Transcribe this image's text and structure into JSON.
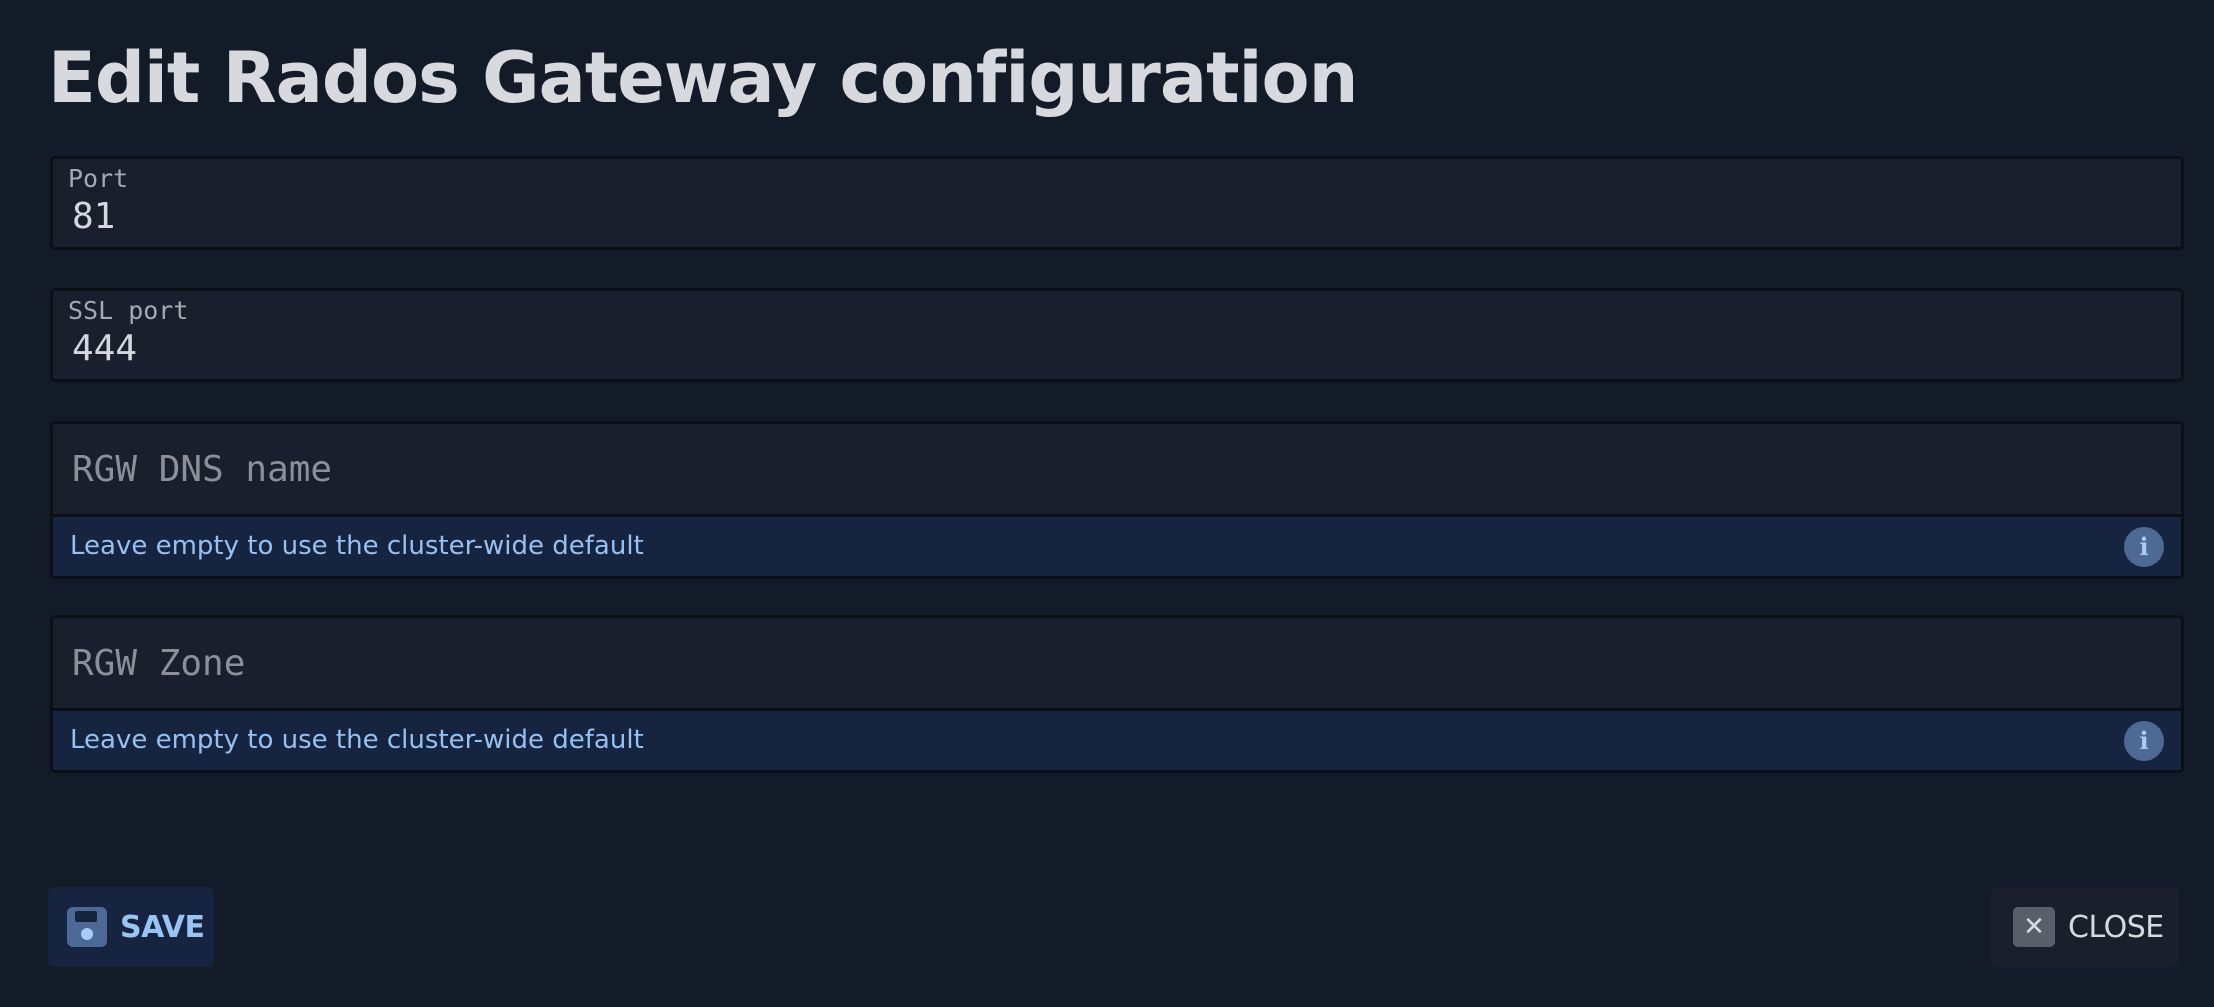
{
  "title": "Edit Rados Gateway configuration",
  "fields": {
    "port": {
      "label": "Port",
      "value": "81"
    },
    "ssl_port": {
      "label": "SSL port",
      "value": "444"
    },
    "rgw_dns_name": {
      "placeholder": "RGW DNS name",
      "value": "",
      "hint": "Leave empty to use the cluster-wide default",
      "icon": "info-icon"
    },
    "rgw_zone": {
      "placeholder": "RGW Zone",
      "value": "",
      "hint": "Leave empty to use the cluster-wide default",
      "icon": "info-icon"
    }
  },
  "actions": {
    "save": {
      "label": "SAVE",
      "icon": "save-icon"
    },
    "close": {
      "label": "CLOSE",
      "icon": "close-icon"
    }
  },
  "colors": {
    "background": "#131a28",
    "field_background": "#1a1f2e",
    "hint_background": "#172440",
    "hint_text": "#93c1f3",
    "accent": "#97c4f5"
  }
}
